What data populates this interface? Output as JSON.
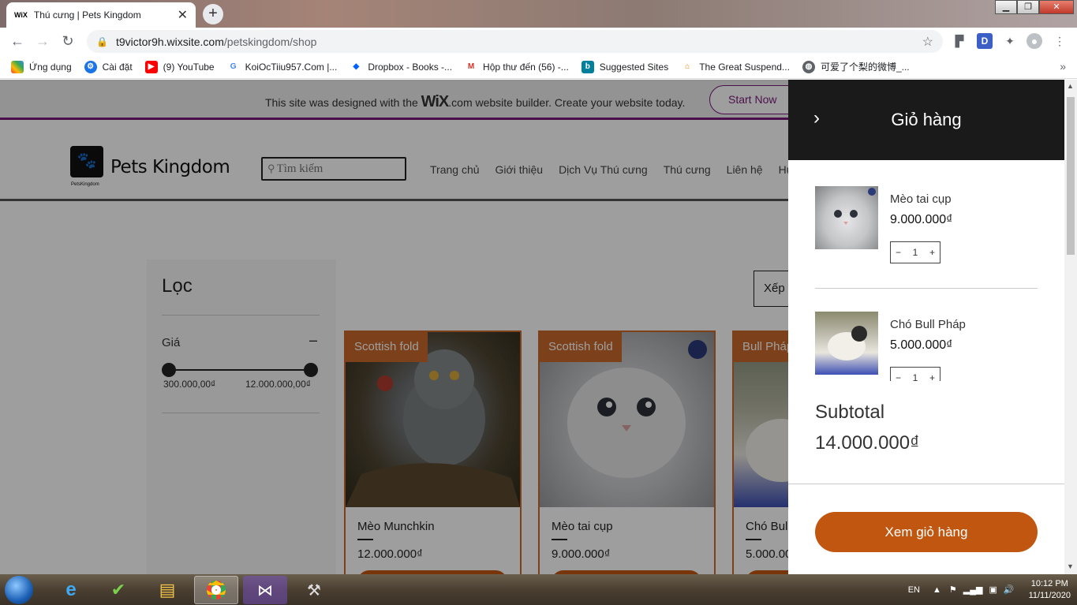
{
  "browser": {
    "tab_title": "Thú cưng | Pets Kingdom",
    "tab_favicon": "WiX",
    "url_host": "t9victor9h.wixsite.com",
    "url_path": "/petskingdom/shop"
  },
  "bookmarks": [
    {
      "label": "Ứng dụng",
      "icon": "apps-grid-icon"
    },
    {
      "label": "Cài đặt",
      "icon": "gear-icon"
    },
    {
      "label": "(9) YouTube",
      "icon": "youtube-icon"
    },
    {
      "label": "KoiOcTiiu957.Com |...",
      "icon": "google-icon"
    },
    {
      "label": "Dropbox - Books -...",
      "icon": "dropbox-icon"
    },
    {
      "label": "Hộp thư đến (56) -...",
      "icon": "gmail-icon"
    },
    {
      "label": "Suggested Sites",
      "icon": "bing-icon"
    },
    {
      "label": "The Great Suspend...",
      "icon": "suspender-icon"
    },
    {
      "label": "可爱了个梨的微博_...",
      "icon": "globe-icon"
    }
  ],
  "wix_banner": {
    "before": "This site was designed with the",
    "wix": "WiX",
    "after": ".com website builder. Create your website today.",
    "start_now": "Start Now"
  },
  "site": {
    "brand": "Pets Kingdom",
    "logo_sub": "PetsKingdom",
    "search_placeholder": "Tìm kiếm",
    "menu": [
      "Trang chủ",
      "Giới thiệu",
      "Dịch Vụ Thú cưng",
      "Thú cưng",
      "Liên hệ",
      "Hư"
    ]
  },
  "filter": {
    "title": "Lọc",
    "price_label": "Giá",
    "min": "300.000,00₫",
    "max": "12.000.000,00₫"
  },
  "sort_label": "Xếp",
  "products": [
    {
      "ribbon": "Scottish fold",
      "name": "Mèo Munchkin",
      "price": "12.000.000₫"
    },
    {
      "ribbon": "Scottish fold",
      "name": "Mèo tai cụp",
      "price": "9.000.000₫"
    },
    {
      "ribbon": "Bull Pháp",
      "name": "Chó Bull",
      "price": "5.000.00"
    }
  ],
  "cart": {
    "title": "Giỏ hàng",
    "items": [
      {
        "name": "Mèo tai cụp",
        "price": "9.000.000₫",
        "qty": "1"
      },
      {
        "name": "Chó Bull Pháp",
        "price": "5.000.000₫",
        "qty": "1"
      }
    ],
    "subtotal_label": "Subtotal",
    "subtotal_value": "14.000.000₫",
    "view_cart": "Xem giỏ hàng"
  },
  "taskbar": {
    "lang": "EN",
    "time": "10:12 PM",
    "date": "11/11/2020"
  }
}
